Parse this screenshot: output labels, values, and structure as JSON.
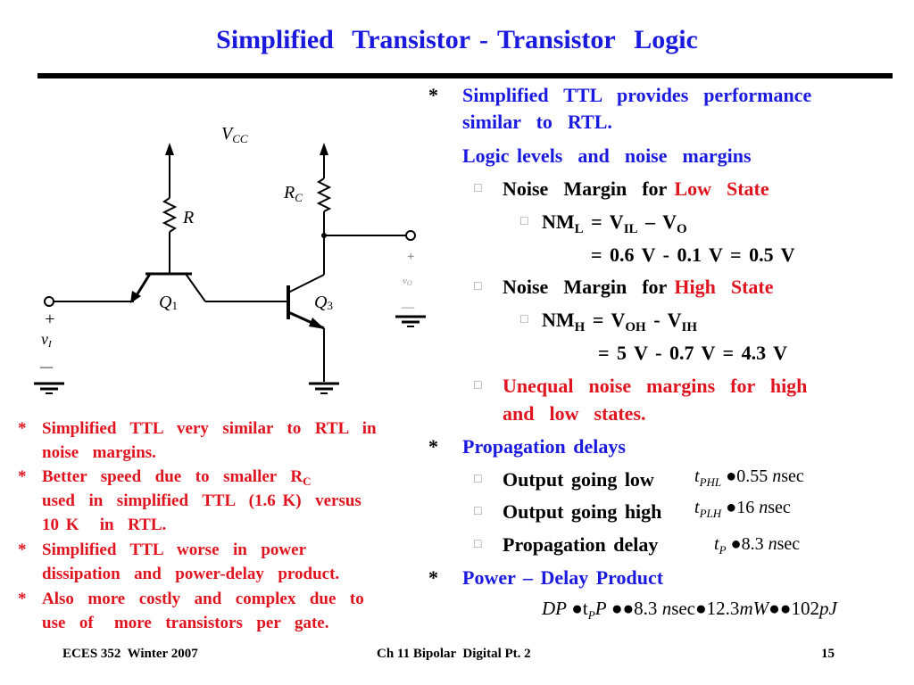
{
  "title": "Simplified  Transistor - Transistor  Logic",
  "circuit": {
    "vcc": "V",
    "vcc_sub": "CC",
    "r": "R",
    "rc": "R",
    "rc_sub": "C",
    "q1": "Q",
    "q1_sub": "1",
    "q3": "Q",
    "q3_sub": "3",
    "vi": "v",
    "vi_sub": "I",
    "vo": "v",
    "vo_sub": "O",
    "plus": "+",
    "minus": "—"
  },
  "right": {
    "star": "*",
    "box": "□",
    "intro1": "Simplified  TTL  provides  performance",
    "intro2": "similar  to  RTL.",
    "logic_levels": "Logic levels  and  noise  margins",
    "nm_low_prefix": "Noise  Margin  for ",
    "nm_low_state": "Low  State",
    "nml": {
      "a": "NM",
      "a_sub": "L",
      "b": " = V",
      "b_sub": "IL",
      "c": " – V",
      "c_sub": "O"
    },
    "nml_value": "= 0.6 V - 0.1 V = 0.5 V",
    "nm_high_prefix": "Noise  Margin  for ",
    "nm_high_state": "High  State",
    "nmh": {
      "a": "NM",
      "a_sub": "H",
      "b": " = V",
      "b_sub": "OH",
      "c": " - V",
      "c_sub": "IH"
    },
    "nmh_value": "= 5 V - 0.7 V = 4.3 V",
    "unequal1": "Unequal  noise  margins  for  high",
    "unequal2": "and  low  states.",
    "prop_delays": "Propagation delays",
    "delays": [
      {
        "label": "Output going low",
        "sym": "t",
        "sym_sub": "PHL",
        "value": "●0.55 ",
        "unit_n": "n",
        "unit": "sec"
      },
      {
        "label": "Output going high",
        "sym": "t",
        "sym_sub": "PLH",
        "value": "●16 ",
        "unit_n": "n",
        "unit": "sec"
      },
      {
        "label": "Propagation delay",
        "sym": "t",
        "sym_sub": "P",
        "value": "●8.3 ",
        "unit_n": "n",
        "unit": "sec"
      }
    ],
    "pdp": "Power – Delay Product",
    "dp": {
      "a": "DP",
      "b": " ●t",
      "b_sub": "P",
      "c": "P",
      "d": " ●●8.3 ",
      "e": "n",
      "f": "sec●12.3",
      "g": "mW",
      "h": "●●102",
      "i": "pJ"
    }
  },
  "left": {
    "bullets": [
      {
        "star": "*",
        "lines": [
          "Simplified  TTL  very  similar  to  RTL  in",
          "noise  margins."
        ]
      },
      {
        "star": "*",
        "lines": [
          "Better  speed  due  to  smaller  R",
          "used  in  simplified  TTL  (1.6 K)  versus",
          "10 K   in  RTL."
        ],
        "sub": "C"
      },
      {
        "star": "*",
        "lines": [
          "Simplified  TTL  worse  in  power",
          "dissipation  and  power-delay  product."
        ]
      },
      {
        "star": "*",
        "lines": [
          "Also  more  costly  and  complex  due  to",
          "use  of   more  transistors  per  gate."
        ]
      }
    ]
  },
  "footer": {
    "left": "ECES 352  Winter 2007",
    "center": "Ch 11 Bipolar  Digital Pt. 2",
    "page": "15"
  },
  "colors": {
    "title": "#1a1adf",
    "highlight": "#e0141e",
    "text": "#000000"
  }
}
